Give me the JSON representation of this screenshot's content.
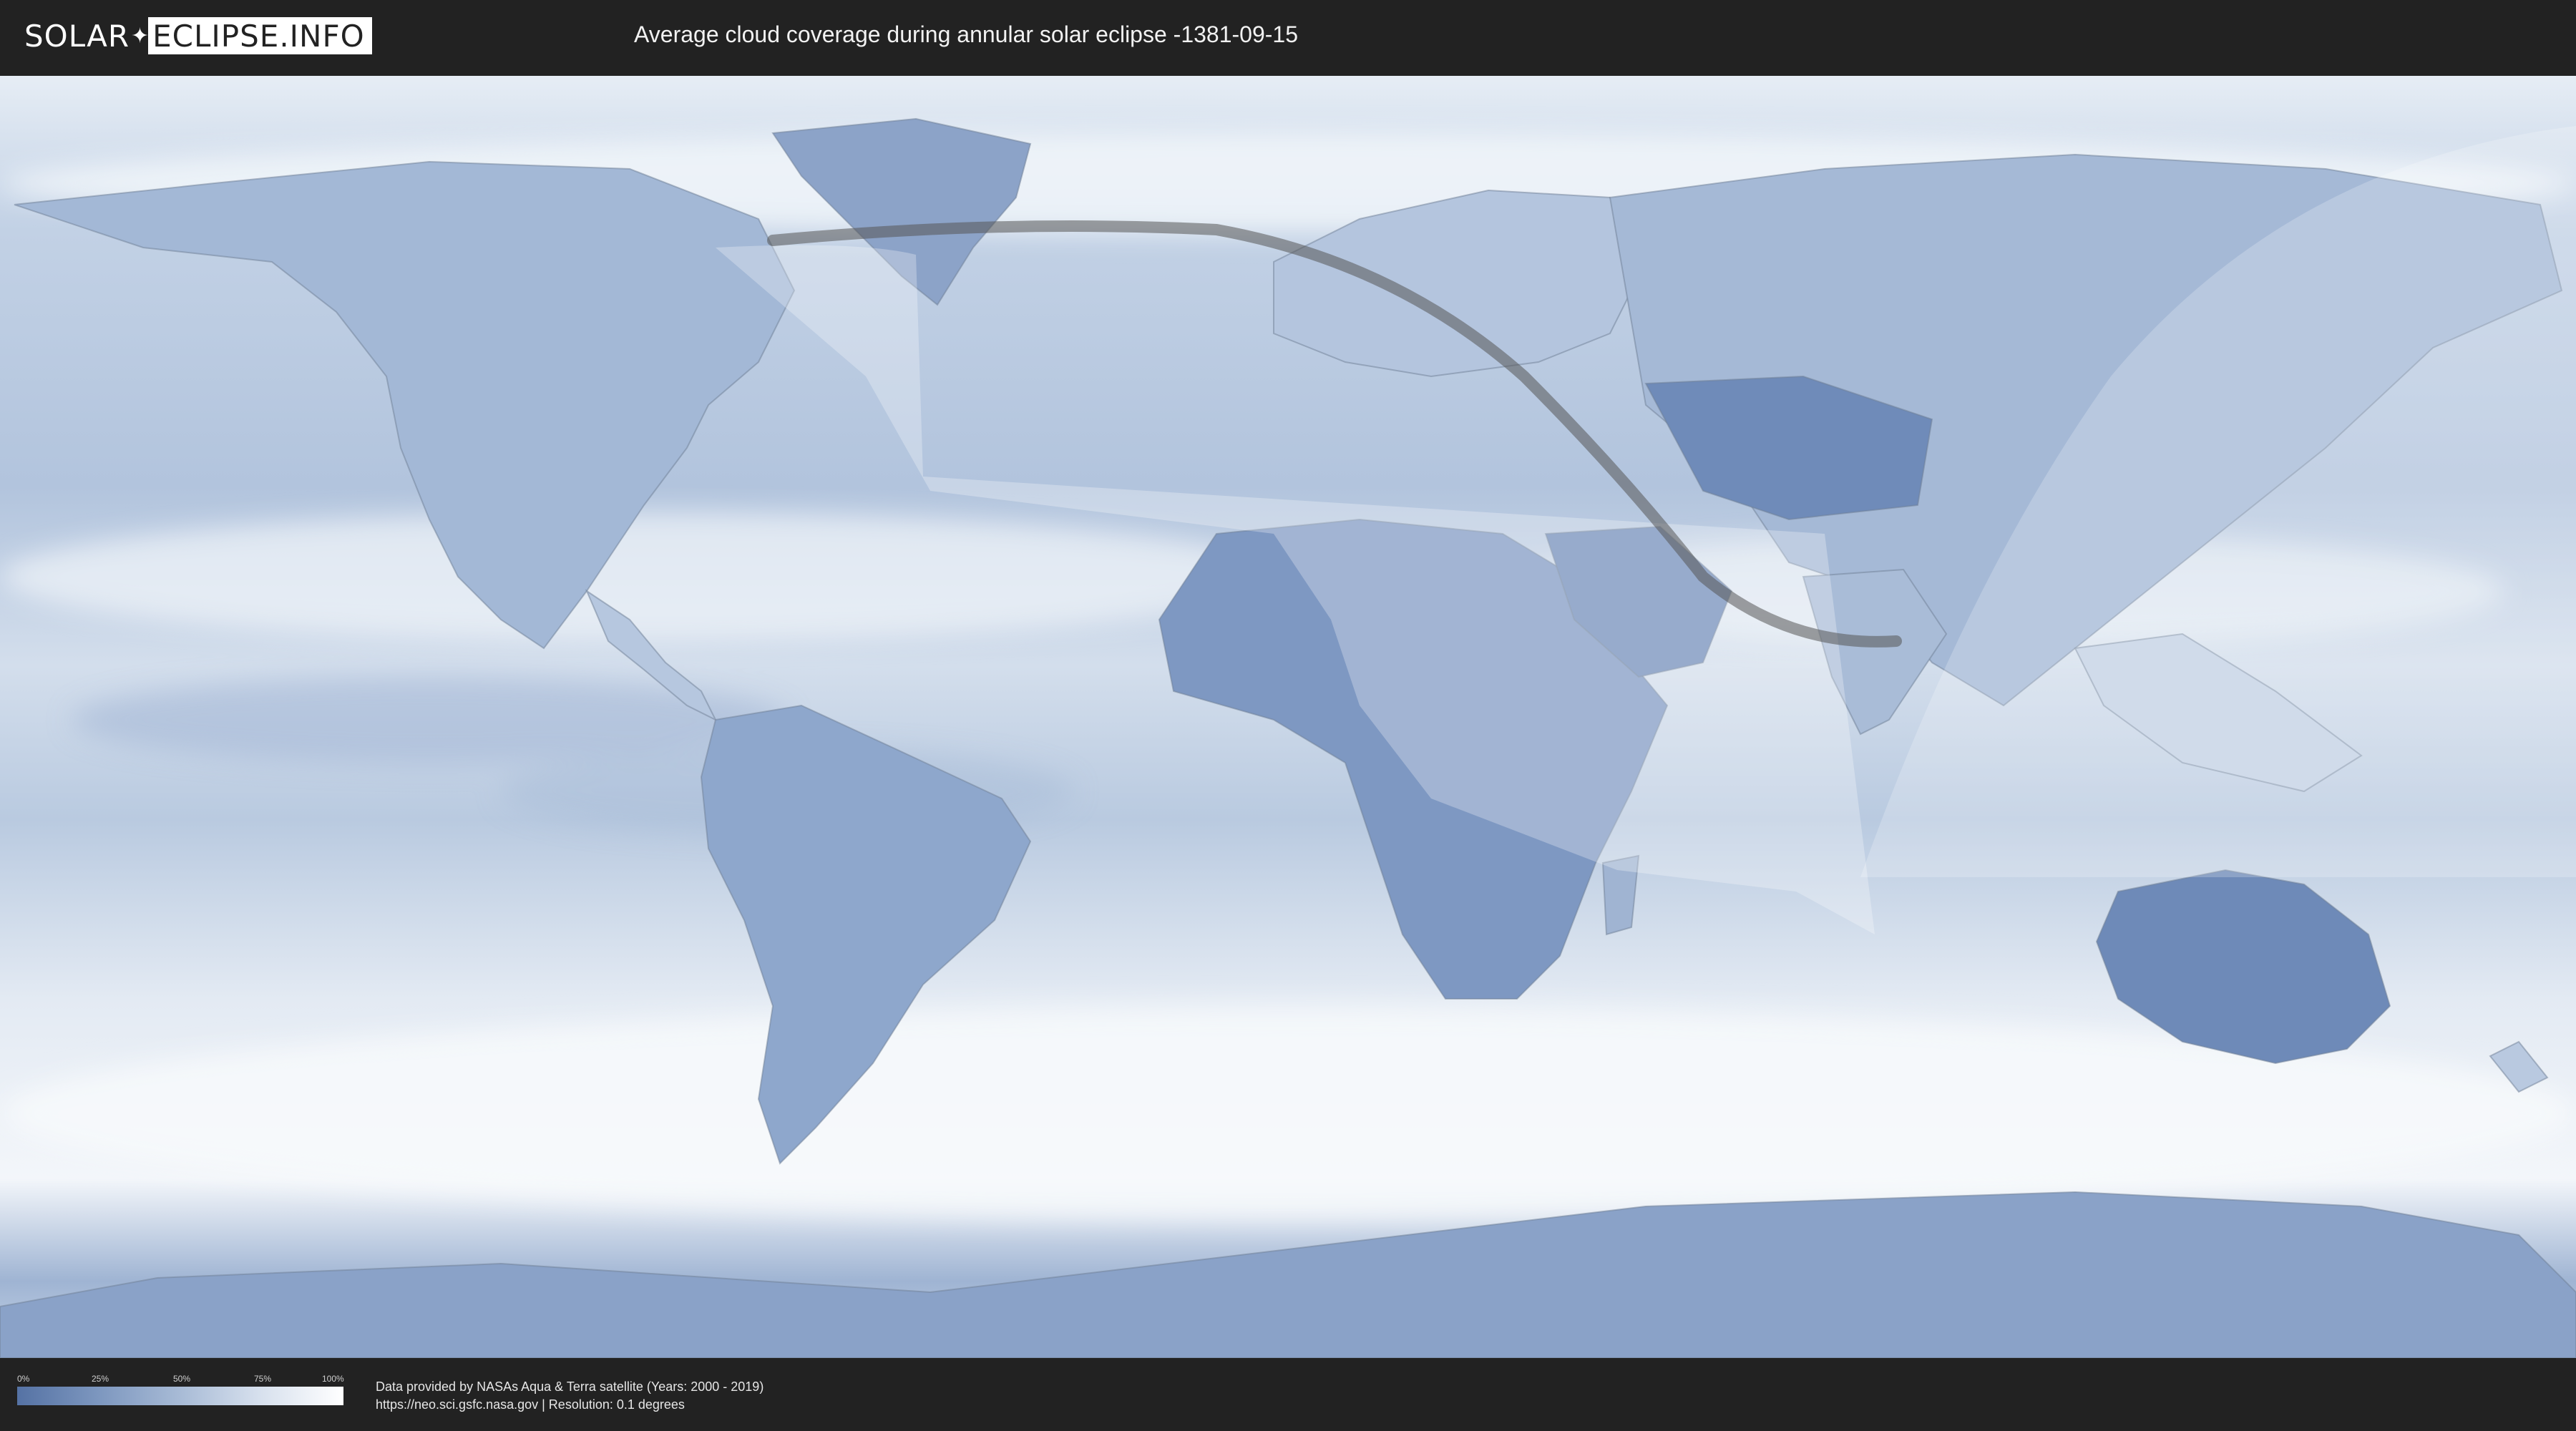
{
  "header": {
    "logo_left": "SOLAR",
    "logo_mark": "✦",
    "logo_right": "ECLIPSE.INFO",
    "title": "Average cloud coverage during annular solar eclipse -1381-09-15"
  },
  "legend": {
    "ticks": [
      "0%",
      "25%",
      "50%",
      "75%",
      "100%"
    ],
    "gradient": [
      "#5572a4",
      "#7d97bf",
      "#a8bbd6",
      "#d8e1ee",
      "#ffffff"
    ]
  },
  "credits": {
    "line1": "Data provided by NASAs Aqua & Terra satellite (Years: 2000 - 2019)",
    "line2": "https://neo.sci.gsfc.nasa.gov | Resolution: 0.1 degrees"
  },
  "colors": {
    "background": "#222222",
    "clear_sky": "#5572a4",
    "overcast": "#ffffff",
    "eclipse_path": "#555555"
  }
}
